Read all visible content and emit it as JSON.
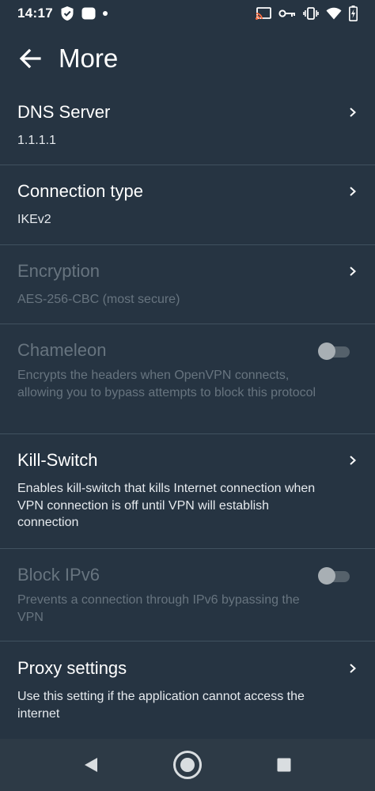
{
  "status_bar": {
    "time": "14:17"
  },
  "header": {
    "title": "More"
  },
  "items": [
    {
      "title": "DNS Server",
      "subtitle": "1.1.1.1"
    },
    {
      "title": "Connection type",
      "subtitle": "IKEv2"
    },
    {
      "title": "Encryption",
      "subtitle": "AES-256-CBC (most secure)"
    },
    {
      "title": "Chameleon",
      "subtitle": "Encrypts the headers when OpenVPN connects, allowing you to bypass attempts to block this protocol",
      "toggle_on": false
    },
    {
      "title": "Kill-Switch",
      "subtitle": "Enables kill-switch that kills Internet connection when VPN connection is off until VPN will establish connection"
    },
    {
      "title": "Block IPv6",
      "subtitle": "Prevents a connection through IPv6 bypassing the VPN",
      "toggle_on": false
    },
    {
      "title": "Proxy settings",
      "subtitle": "Use this setting if the application cannot access the internet"
    }
  ],
  "colors": {
    "background": "#263442",
    "disabled_text": "#67747f",
    "divider": "#40515f"
  },
  "icons": [
    "shield-icon",
    "notification-icon",
    "cast-icon",
    "vpn-key-icon",
    "vibrate-icon",
    "wifi-icon",
    "battery-icon",
    "back-arrow-icon",
    "chevron-right-icon",
    "nav-back-icon",
    "nav-home-icon",
    "nav-recents-icon"
  ]
}
